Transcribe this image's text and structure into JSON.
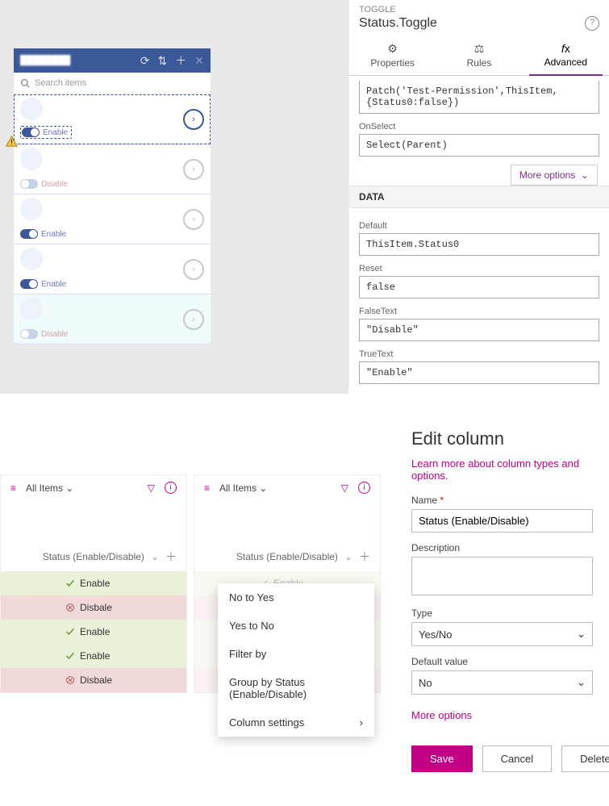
{
  "pa": {
    "type": "TOGGLE",
    "name": "Status.Toggle",
    "tabs": {
      "properties": "Properties",
      "rules": "Rules",
      "advanced": "Advanced"
    },
    "formula": "Patch('Test-Permission',ThisItem,{Status0:false})",
    "onselect_lbl": "OnSelect",
    "onselect": "Select(Parent)",
    "more": "More options",
    "data_header": "DATA",
    "fields": {
      "default_lbl": "Default",
      "default": "ThisItem.Status0",
      "reset_lbl": "Reset",
      "reset": "false",
      "false_lbl": "FalseText",
      "false": "\"Disable\"",
      "true_lbl": "TrueText",
      "true": "\"Enable\""
    }
  },
  "canvas": {
    "title": "████████",
    "search_ph": "Search items",
    "rows": [
      {
        "on": true,
        "lbl": "Enable",
        "sel": true
      },
      {
        "on": false,
        "lbl": "Disable"
      },
      {
        "on": true,
        "lbl": "Enable"
      },
      {
        "on": true,
        "lbl": "Enable"
      },
      {
        "on": false,
        "lbl": "Disable"
      }
    ]
  },
  "sp": {
    "allitems": "All Items",
    "colname": "Status (Enable/Disable)",
    "rows": [
      {
        "v": "Enable",
        "ok": true
      },
      {
        "v": "Disbale",
        "ok": false
      },
      {
        "v": "Enable",
        "ok": true
      },
      {
        "v": "Enable",
        "ok": true
      },
      {
        "v": "Disbale",
        "ok": false
      }
    ],
    "menu": [
      "No to Yes",
      "Yes to No",
      "Filter by",
      "Group by Status (Enable/Disable)",
      "Column settings"
    ]
  },
  "edit": {
    "title": "Edit column",
    "learn": "Learn more about column types and options.",
    "name_lbl": "Name",
    "name": "Status (Enable/Disable)",
    "desc_lbl": "Description",
    "desc": "",
    "type_lbl": "Type",
    "type": "Yes/No",
    "default_lbl": "Default value",
    "default": "No",
    "more": "More options",
    "save": "Save",
    "cancel": "Cancel",
    "delete": "Delete"
  }
}
